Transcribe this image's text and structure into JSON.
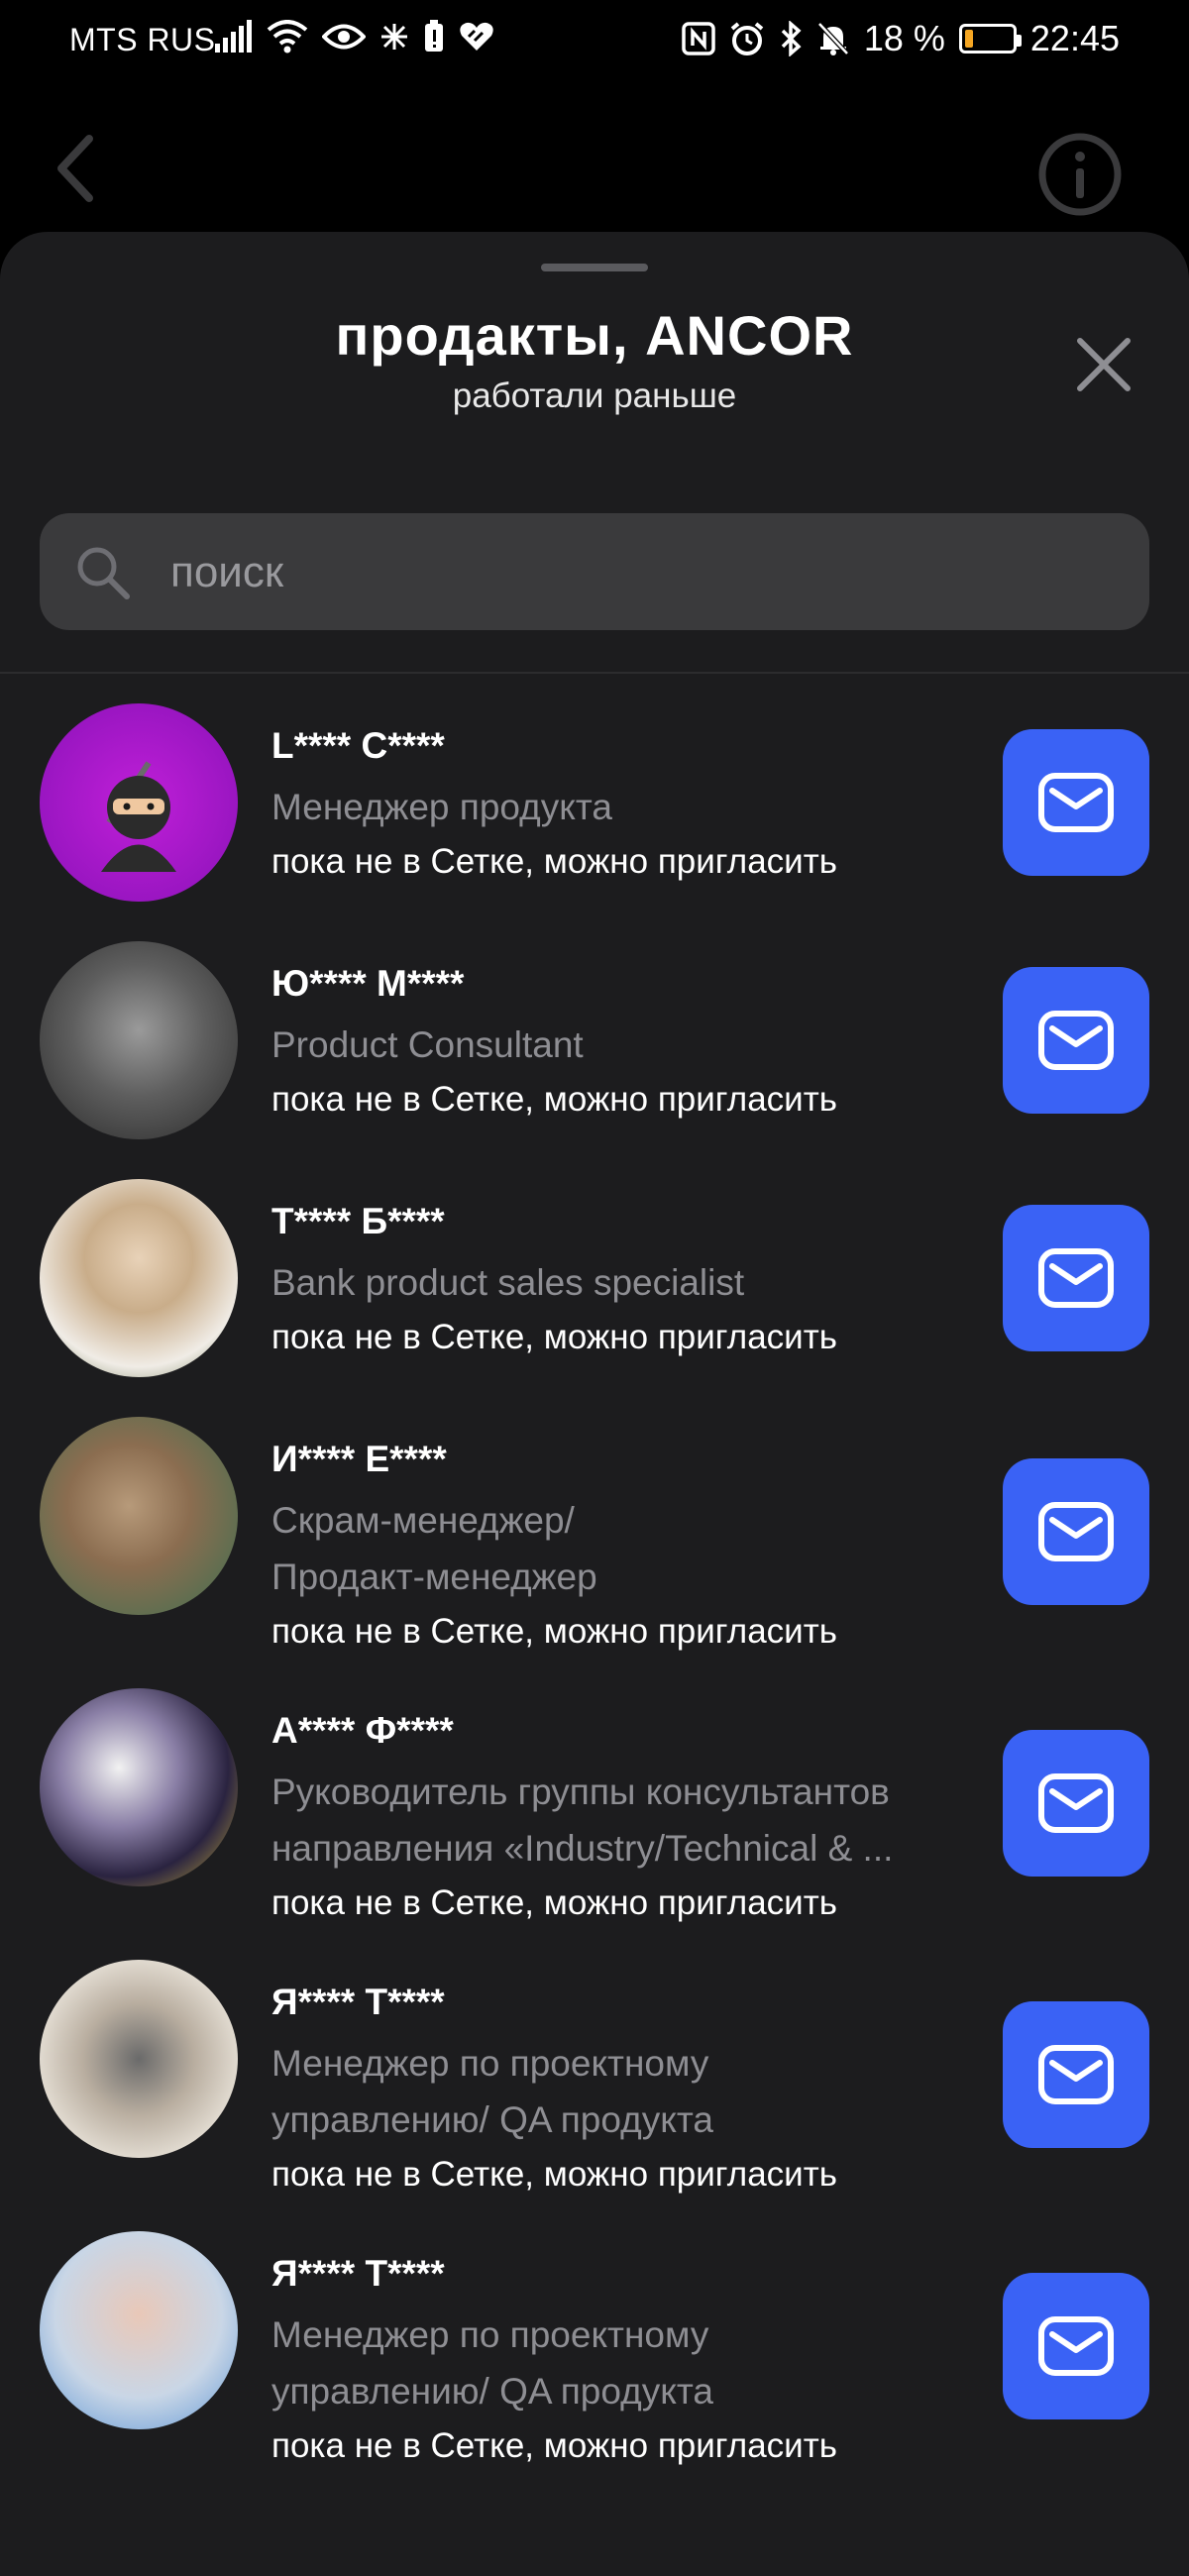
{
  "status_bar": {
    "carrier": "MTS RUS",
    "battery_percent": "18 %",
    "battery_level": 0.18,
    "time": "22:45"
  },
  "sheet": {
    "title": "продакты, ANCOR",
    "subtitle": "работали раньше"
  },
  "search": {
    "placeholder": "поиск"
  },
  "colors": {
    "accent": "#3a62f5",
    "sheet_bg": "#1c1c1e",
    "search_bg": "#3a3a3c",
    "muted_text": "#8e8e93"
  },
  "contacts": [
    {
      "name": "L**** C****",
      "role_lines": [
        "Менеджер продукта"
      ],
      "status": "пока не в Сетке, можно пригласить",
      "avatar": "ninja-emoji"
    },
    {
      "name": "Ю**** М****",
      "role_lines": [
        "Product Consultant"
      ],
      "status": "пока не в Сетке, можно пригласить",
      "avatar": "blurred-photo"
    },
    {
      "name": "Т**** Б****",
      "role_lines": [
        "Bank product sales specialist"
      ],
      "status": "пока не в Сетке, можно пригласить",
      "avatar": "blurred-photo"
    },
    {
      "name": "И**** Е****",
      "role_lines": [
        "Скрам-менеджер/",
        "Продакт-менеджер"
      ],
      "status": "пока не в Сетке, можно пригласить",
      "avatar": "blurred-photo"
    },
    {
      "name": "А**** Ф****",
      "role_lines": [
        "Руководитель группы консультантов",
        "направления «Industry/Technical & ..."
      ],
      "status": "пока не в Сетке, можно пригласить",
      "avatar": "blurred-photo"
    },
    {
      "name": "Я**** Т****",
      "role_lines": [
        "Менеджер по проектному",
        "управлению/ QA продукта"
      ],
      "status": "пока не в Сетке, можно пригласить",
      "avatar": "blurred-photo"
    },
    {
      "name": "Я**** Т****",
      "role_lines": [
        "Менеджер по проектному",
        "управлению/ QA продукта"
      ],
      "status": "пока не в Сетке, можно пригласить",
      "avatar": "blurred-photo"
    }
  ]
}
